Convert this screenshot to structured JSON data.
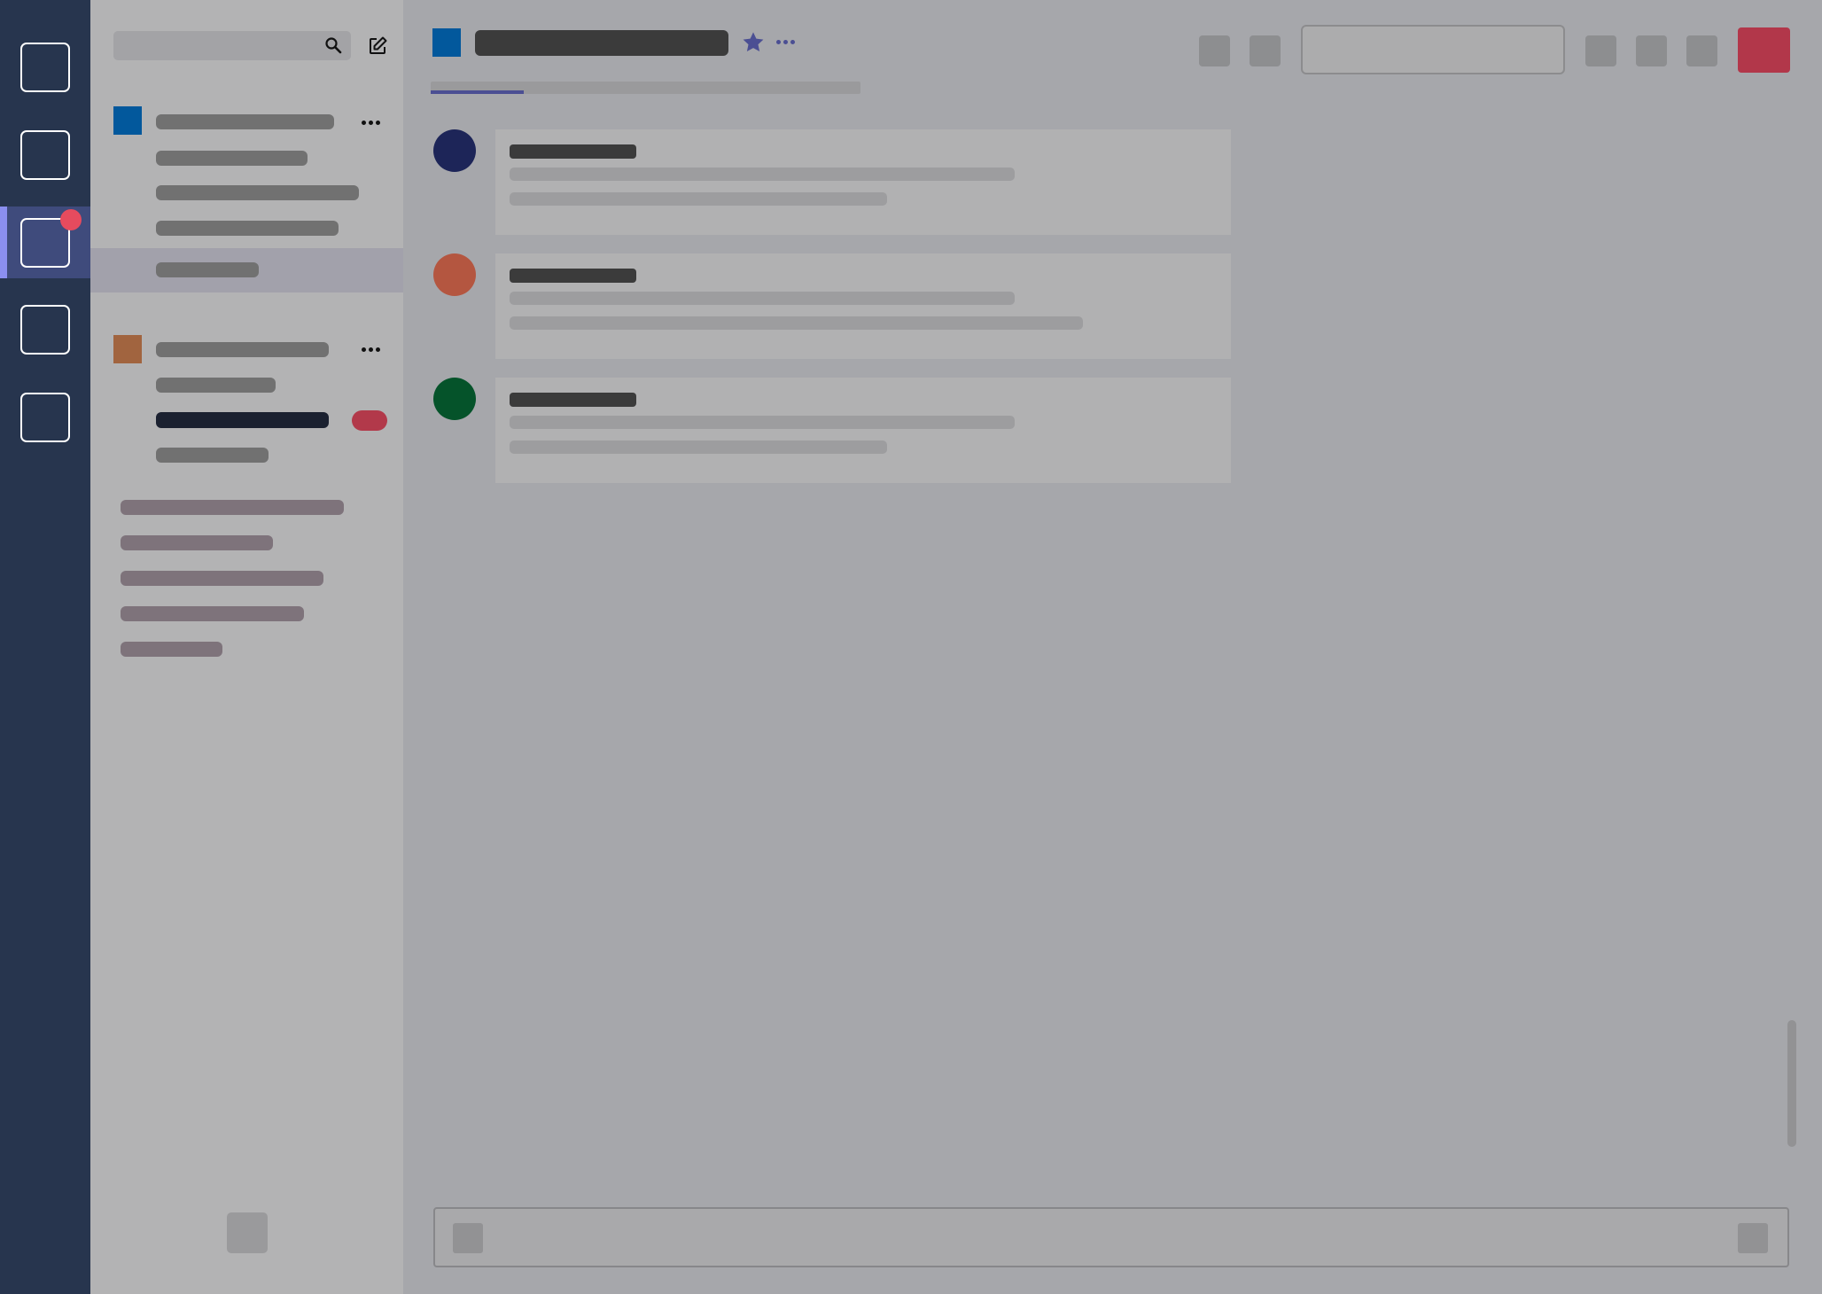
{
  "rail": {
    "items": [
      {
        "icon": "app-icon"
      },
      {
        "icon": "app-icon"
      },
      {
        "icon": "app-icon",
        "active": true,
        "has_notification": true
      },
      {
        "icon": "app-icon"
      },
      {
        "icon": "app-icon"
      }
    ],
    "active_index": 2,
    "notification_color": "#e64b5e"
  },
  "sidebar": {
    "search_icon": "search-icon",
    "compose_icon": "compose-icon",
    "groups": [
      {
        "color": "#02589c",
        "menu_icon": "more-horizontal-icon",
        "selected_item_index": 4
      },
      {
        "color": "#a1643f",
        "menu_icon": "more-horizontal-icon",
        "unread_item_index": 2,
        "badge_color": "#b2394a"
      }
    ],
    "footer_button_icon": "settings-icon"
  },
  "header": {
    "channel_color": "#02589c",
    "star_icon": "star-icon",
    "menu_icon": "more-horizontal-icon",
    "accent_color": "#4b4f93",
    "primary_button_color": "#b2374a"
  },
  "messages": [
    {
      "avatar_color": "#1d2558"
    },
    {
      "avatar_color": "#b45640"
    },
    {
      "avatar_color": "#05532a"
    }
  ],
  "composer": {
    "left_icon": "attach-icon",
    "right_icon": "send-icon"
  }
}
